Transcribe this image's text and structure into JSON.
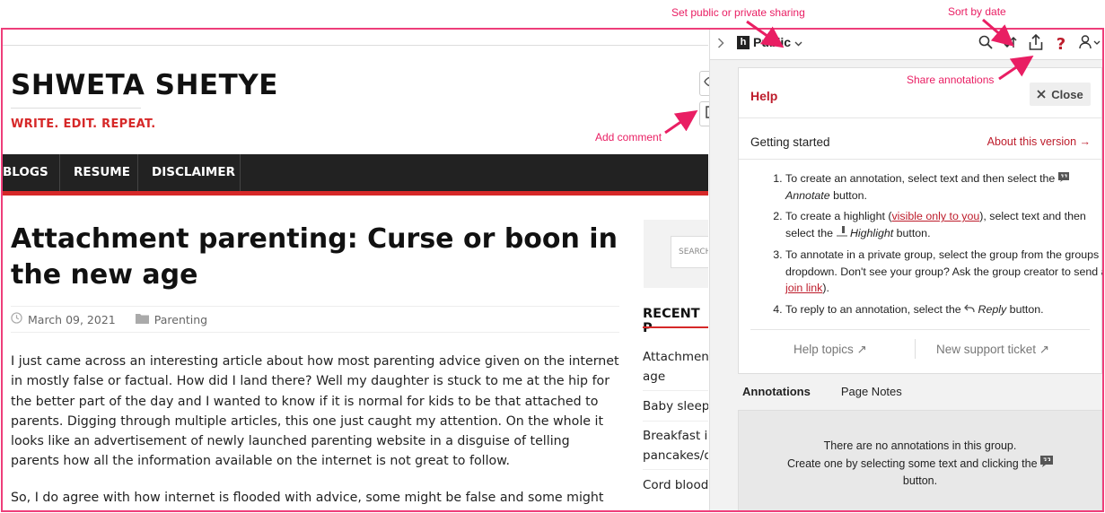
{
  "annotations": {
    "set_sharing": "Set public or private sharing",
    "sort_by_date": "Sort by date",
    "share_annotations": "Share annotations",
    "add_comment": "Add comment"
  },
  "blog": {
    "site_title": "SHWETA SHETYE",
    "tagline": "WRITE. EDIT. REPEAT.",
    "nav": [
      "BLOGS",
      "RESUME",
      "DISCLAIMER"
    ],
    "post_title": "Attachment parenting: Curse or boon in the new age",
    "date": "March 09, 2021",
    "category": "Parenting",
    "paragraph1": "I just came across an interesting article about how most parenting advice given on the internet in mostly false or factual. How did I land there? Well my daughter is stuck to me at the hip for the better part of the day and I wanted to know if it is normal for kids to be that attached to parents. Digging through multiple articles, this one just caught my attention. On the whole it looks like an advertisement of newly launched parenting website in a disguise of telling parents how all the information available on the internet is not great to follow.",
    "paragraph2": "So, I do agree with how internet is flooded with advice, some might be false and some might be true.",
    "search_placeholder": "SEARCH",
    "recent_title": "RECENT P",
    "recent_items": [
      "Attachment age",
      "Baby sleepi",
      "Breakfast ic pancakes/d",
      "Cord blood"
    ]
  },
  "sidebar": {
    "group": "Public",
    "help": {
      "title": "Help",
      "close_label": "Close",
      "getting_started": "Getting started",
      "about_version": "About this version →",
      "step1_a": "To create an annotation, select text and then select the",
      "step1_b": "Annotate",
      "step1_c": "button.",
      "step2_a": "To create a highlight (",
      "step2_link": "visible only to you",
      "step2_b": "), select text and then select the",
      "step2_c": "Highlight",
      "step2_d": "button.",
      "step3_a": "To annotate in a private group, select the group from the groups dropdown. Don't see your group? Ask the group creator to send a",
      "step3_link": "join link",
      "step3_b": ").",
      "step4_a": "To reply to an annotation, select the",
      "step4_b": "Reply",
      "step4_c": "button.",
      "help_topics": "Help topics ↗",
      "new_ticket": "New support ticket ↗"
    },
    "tabs": [
      "Annotations",
      "Page Notes"
    ],
    "empty_line1": "There are no annotations in this group.",
    "empty_line2": "Create one by selecting some text and clicking the",
    "empty_line3": "button."
  },
  "colors": {
    "annotation_pink": "#e91e63",
    "brand_red": "#d62828",
    "hypothesis_red": "#bd1c2b"
  }
}
